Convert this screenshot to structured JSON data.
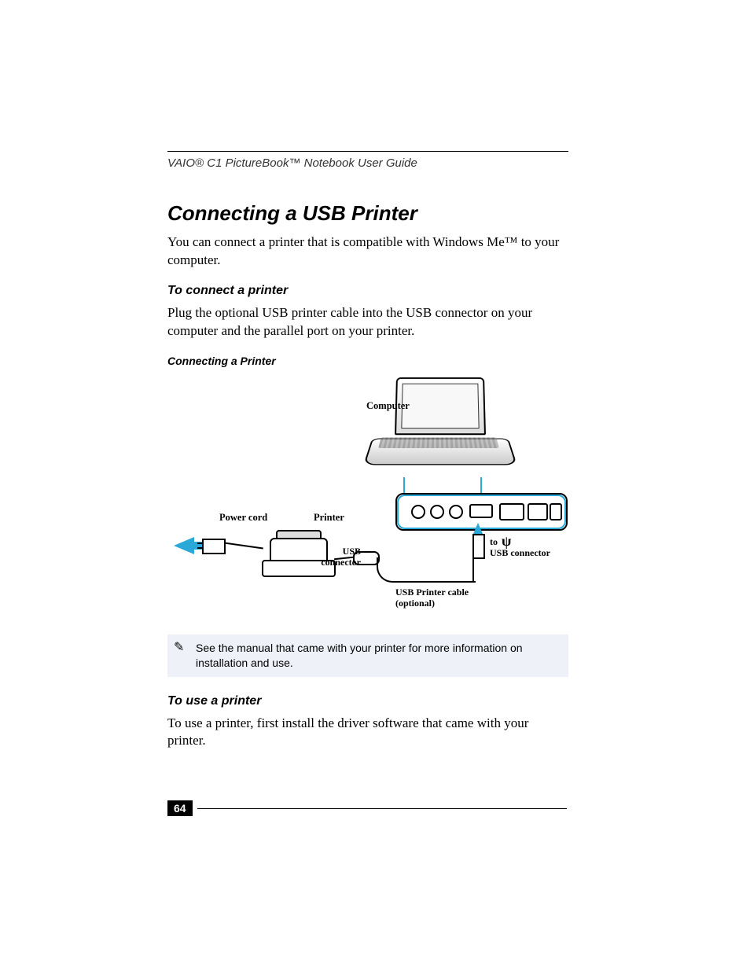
{
  "runningHead": "VAIO® C1 PictureBook™ Notebook User Guide",
  "title": "Connecting a USB Printer",
  "intro": "You can connect a printer that is compatible with Windows Me™ to your computer.",
  "sectionA": {
    "heading": "To connect a printer",
    "body": "Plug the optional USB printer cable into the USB connector on your computer and the parallel port on your printer."
  },
  "figure": {
    "caption": "Connecting a Printer",
    "labels": {
      "computer": "Computer",
      "powerCord": "Power cord",
      "printer": "Printer",
      "usbConnectorLeft": "USB connector",
      "to": "to",
      "usbConnectorRight": "USB connector",
      "cable1": "USB Printer cable",
      "cable2": "(optional)"
    }
  },
  "note": "See the manual that came with your printer for more information on installation and use.",
  "sectionB": {
    "heading": "To use a printer",
    "body": "To use a printer, first install the driver software that came with your printer."
  },
  "pageNumber": "64"
}
